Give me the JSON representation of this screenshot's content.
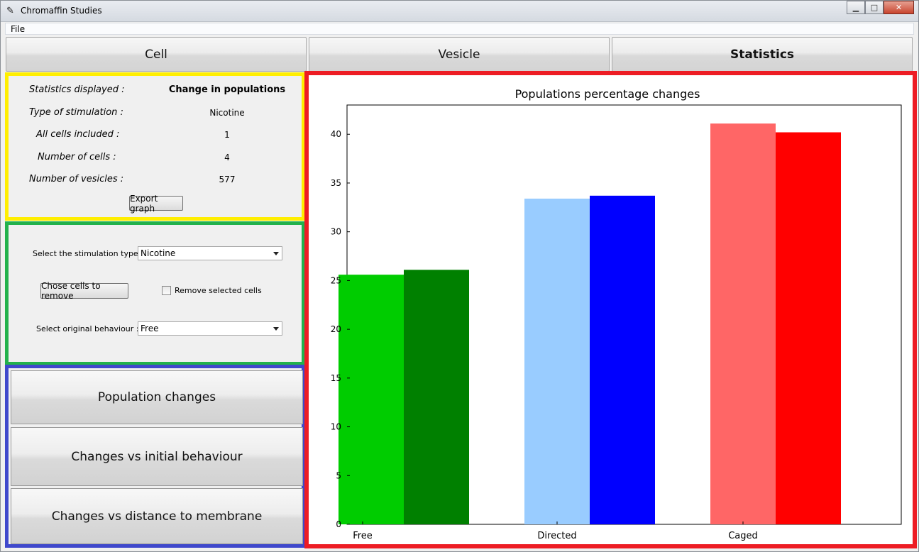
{
  "window": {
    "title": "Chromaffin Studies",
    "minimize": "▁",
    "maximize": "□",
    "close": "✕"
  },
  "menu": {
    "file": "File"
  },
  "tabs": [
    {
      "label": "Cell"
    },
    {
      "label": "Vesicle"
    },
    {
      "label": "Statistics",
      "active": true
    }
  ],
  "stats": {
    "displayed_label": "Statistics displayed :",
    "displayed_value": "Change in populations",
    "stimulation_label": "Type of stimulation :",
    "stimulation_value": "Nicotine",
    "all_cells_label": "All cells included :",
    "all_cells_value": "1",
    "num_cells_label": "Number of cells :",
    "num_cells_value": "4",
    "num_vesicles_label": "Number of vesicles :",
    "num_vesicles_value": "577",
    "export_button": "Export graph"
  },
  "controls": {
    "stim_type_label": "Select the stimulation type :",
    "stim_type_value": "Nicotine",
    "remove_button": "Chose cells to remove",
    "remove_check_label": "Remove selected cells",
    "remove_checked": false,
    "orig_behaviour_label": "Select original behaviour :",
    "orig_behaviour_value": "Free"
  },
  "graph_buttons": [
    {
      "label": "Population changes"
    },
    {
      "label": "Changes vs initial behaviour"
    },
    {
      "label": "Changes vs distance to membrane"
    }
  ],
  "colors": {
    "yellow_frame": "#ffee00",
    "green_frame": "#22b14c",
    "blue_frame": "#3f48cc",
    "red_frame": "#ed1c24"
  },
  "chart_data": {
    "type": "bar",
    "title": "Populations percentage changes",
    "xlabel": "",
    "ylabel": "",
    "categories": [
      "Free",
      "Directed",
      "Caged"
    ],
    "series": [
      {
        "values": [
          25.6,
          33.4,
          41.1
        ],
        "colors": [
          "#00cc00",
          "#99ccff",
          "#ff6666"
        ]
      },
      {
        "values": [
          26.1,
          33.7,
          40.2
        ],
        "colors": [
          "#008000",
          "#0000ff",
          "#ff0000"
        ]
      }
    ],
    "ylim": [
      0,
      43
    ],
    "yticks": [
      "0",
      "5",
      "10",
      "15",
      "20",
      "25",
      "30",
      "35",
      "40"
    ],
    "grid": false
  }
}
